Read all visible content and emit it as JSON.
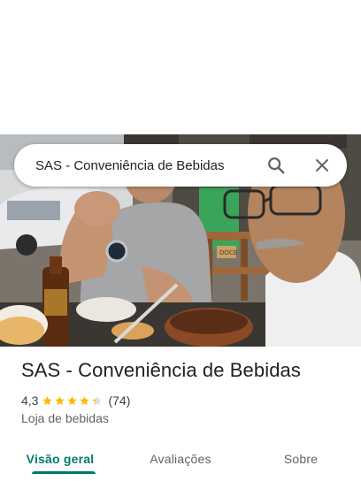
{
  "search": {
    "query": "SAS - Conveniência de Bebidas",
    "search_icon": "search-icon",
    "close_icon": "close-icon"
  },
  "photo": {
    "description_icon": "place-photo",
    "bottle_label": "",
    "sign_text": "DOCE"
  },
  "place": {
    "name": "SAS - Conveniência de Bebidas",
    "rating": "4,3",
    "rating_value": 4.3,
    "stars_total": 5,
    "review_count": "(74)",
    "category": "Loja de bebidas"
  },
  "tabs": [
    {
      "label": "Visão geral",
      "active": true
    },
    {
      "label": "Avaliações",
      "active": false
    },
    {
      "label": "Sobre",
      "active": false
    }
  ],
  "colors": {
    "accent": "#00796b",
    "star": "#fbbc04",
    "star_empty": "#dadce0"
  }
}
